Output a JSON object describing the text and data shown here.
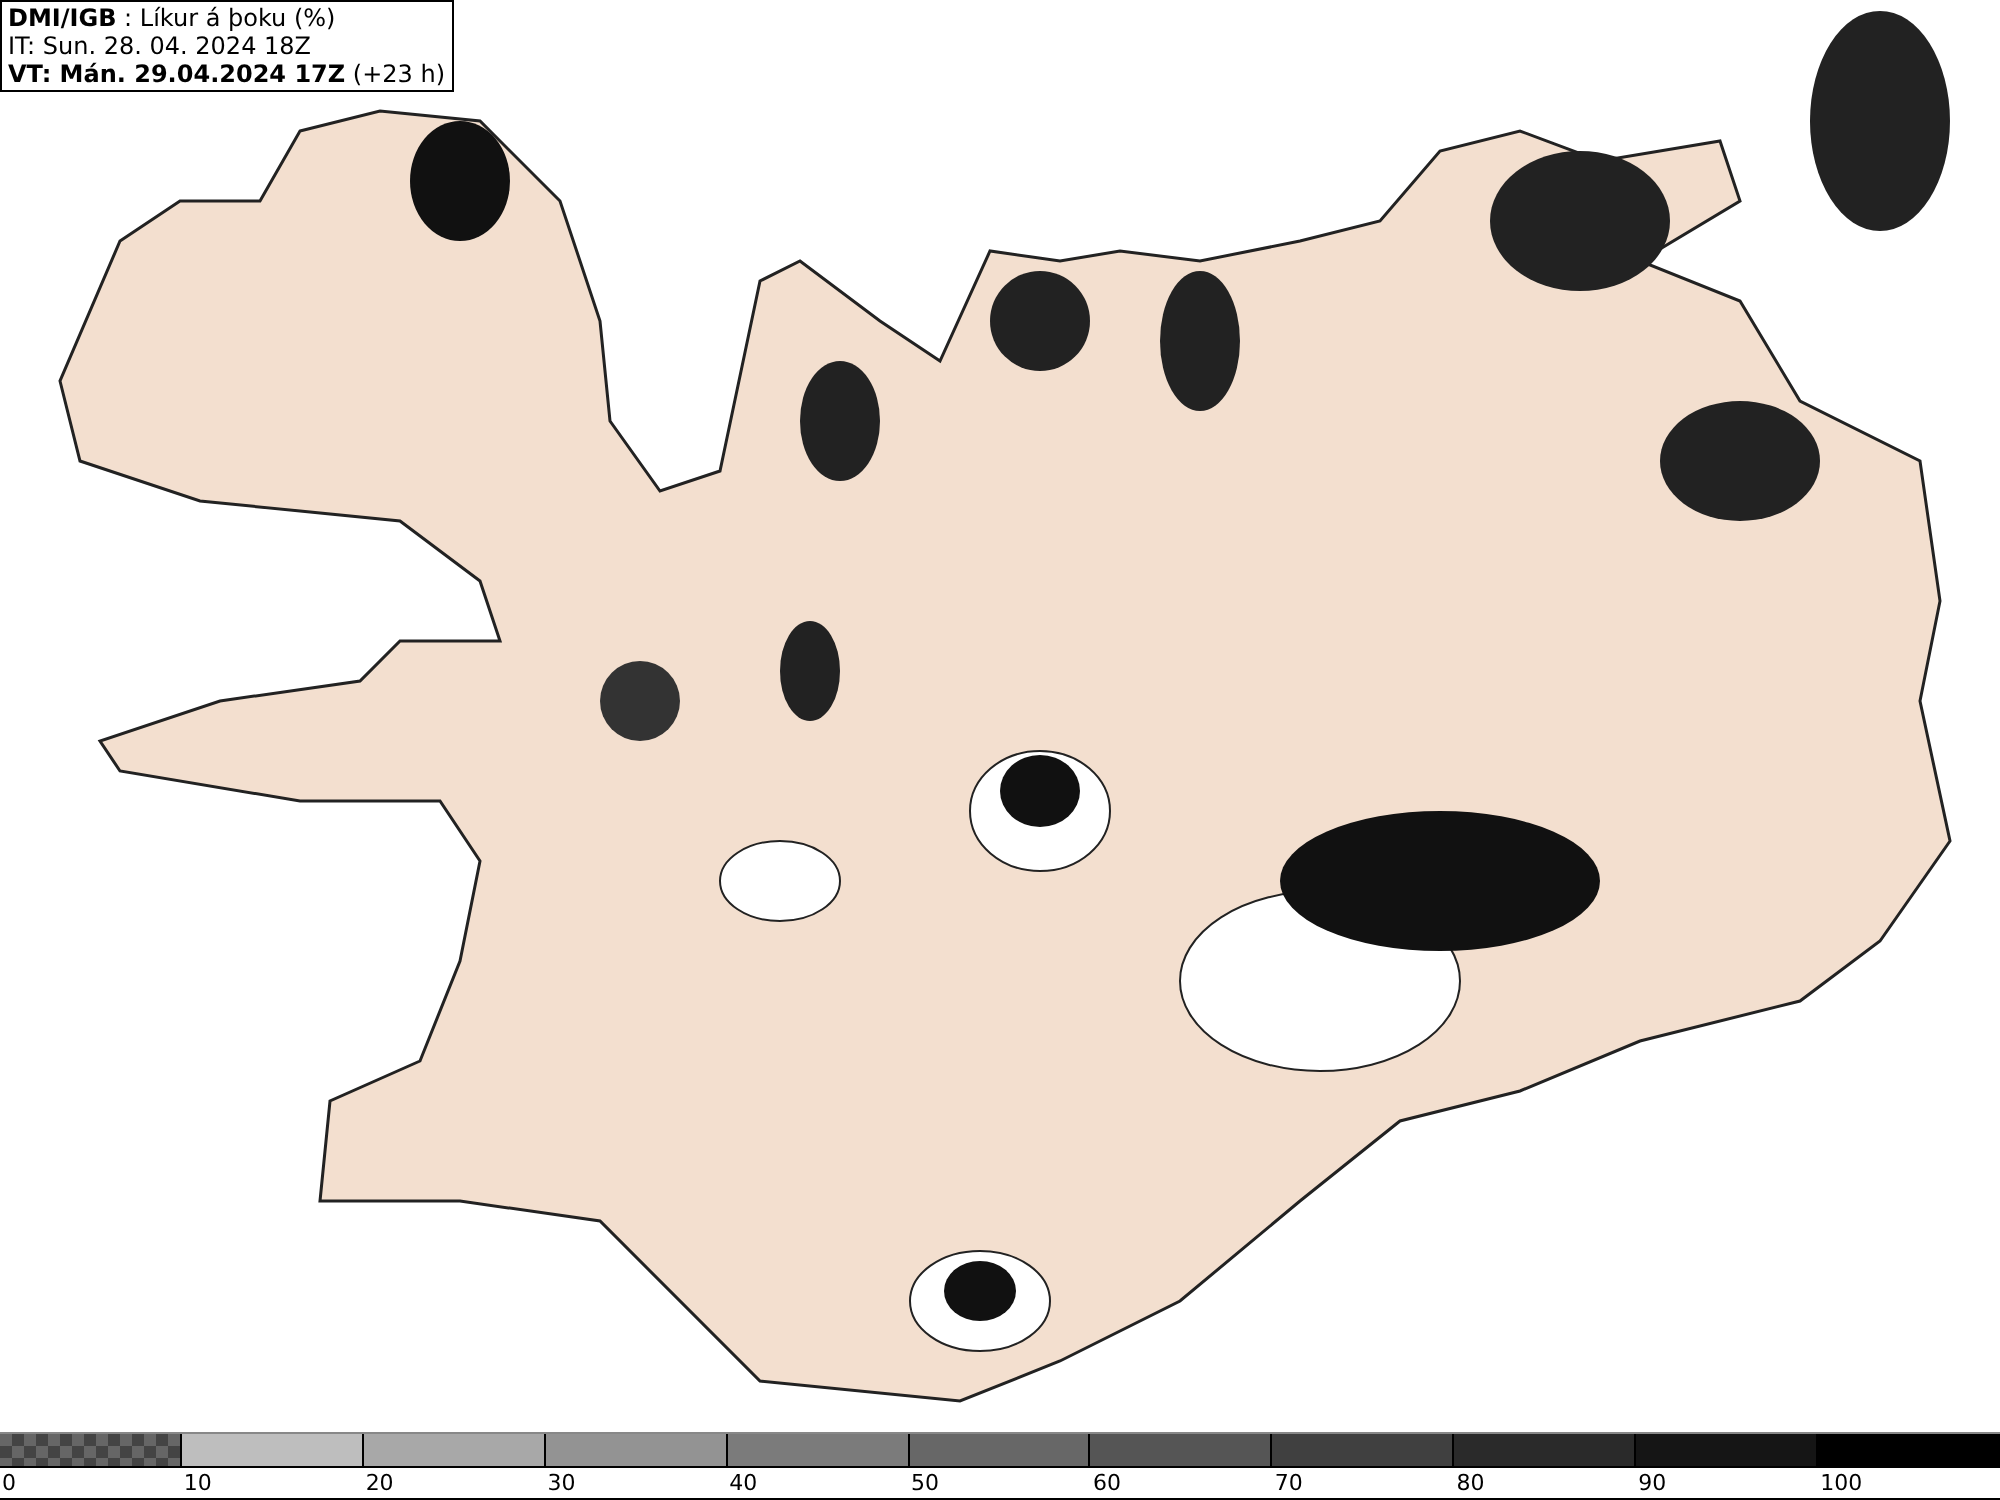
{
  "header": {
    "title": "**DMI/IGB** : Líkur á þoku (%)",
    "issue_time": "IT: Sun. 28. 04. 2024 18Z",
    "valid_time": "**VT: Mán. 29.04.2024 17Z** (+23 h)"
  },
  "legend": [
    {
      "label": "0",
      "kind": "checker",
      "color": "#666666"
    },
    {
      "label": "10",
      "kind": "solid",
      "color": "#bebebe"
    },
    {
      "label": "20",
      "kind": "solid",
      "color": "#a8a8a8"
    },
    {
      "label": "30",
      "kind": "solid",
      "color": "#939393"
    },
    {
      "label": "40",
      "kind": "solid",
      "color": "#7b7b7b"
    },
    {
      "label": "50",
      "kind": "solid",
      "color": "#676767"
    },
    {
      "label": "60",
      "kind": "solid",
      "color": "#555555"
    },
    {
      "label": "70",
      "kind": "solid",
      "color": "#404040"
    },
    {
      "label": "80",
      "kind": "solid",
      "color": "#2a2a2a"
    },
    {
      "label": "90",
      "kind": "solid",
      "color": "#151515"
    },
    {
      "label": "100",
      "kind": "solid",
      "color": "#000000"
    }
  ]
}
